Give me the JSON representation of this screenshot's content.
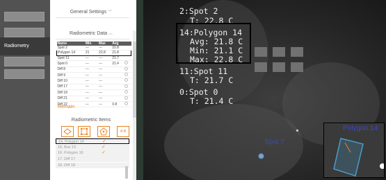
{
  "nav": {
    "active_item": "Radiometry"
  },
  "panel": {
    "general_settings": "General Settings",
    "radiometric_data": "Radiometric Data",
    "table": {
      "headers": [
        "Name",
        "Min",
        "Max",
        "Avg"
      ],
      "rows": [
        {
          "name": "Spot 2",
          "min": "---",
          "max": "---",
          "avg": "22.8"
        },
        {
          "name": "Polygon 14",
          "min": "21",
          "max": "22.8",
          "avg": "21.8"
        },
        {
          "name": "Spot 11",
          "min": "---",
          "max": "---",
          "avg": "21.7"
        },
        {
          "name": "Spot 0",
          "min": "---",
          "max": "---",
          "avg": "21.4"
        },
        {
          "name": "Diff 8",
          "min": "---",
          "max": "---",
          "avg": ""
        },
        {
          "name": "Diff 9",
          "min": "---",
          "max": "---",
          "avg": ""
        },
        {
          "name": "Diff 10",
          "min": "---",
          "max": "---",
          "avg": ""
        },
        {
          "name": "Diff 17",
          "min": "---",
          "max": "---",
          "avg": ""
        },
        {
          "name": "Diff 18",
          "min": "---",
          "max": "---",
          "avg": ""
        },
        {
          "name": "Diff 21",
          "min": "---",
          "max": "---",
          "avg": ""
        },
        {
          "name": "Diff 22",
          "min": "---",
          "max": "---",
          "avg": "0.8"
        }
      ]
    },
    "remain_label": "Remain",
    "radiometric_items": "Radiometric Items",
    "tools": [
      "point-tool",
      "box-tool",
      "polygon-tool",
      "diff-tool"
    ],
    "diff_tool_label": "A-B",
    "list": [
      {
        "label": "14. Polygon 14",
        "checked": true
      },
      {
        "label": "15. Box 15",
        "checked": true
      },
      {
        "label": "16. Polygon 16",
        "checked": true
      },
      {
        "label": "17. Diff 17",
        "checked": false
      },
      {
        "label": "18. Diff 18",
        "checked": false
      }
    ],
    "check_glyph": "✓",
    "accent": "#e8821d"
  },
  "overlay": {
    "spot2": {
      "name": "2:Spot 2",
      "t": "T: 22.8 C"
    },
    "polygon14": {
      "name": "14:Polygon 14",
      "avg": "Avg: 21.8 C",
      "min": "Min: 21.1 C",
      "max": "Max: 22.8 C"
    },
    "spot11": {
      "name": "11:Spot 11",
      "t": "T: 21.7 C"
    },
    "spot0": {
      "name": "0:Spot 0",
      "t": "T: 21.4 C"
    },
    "spot7_label": "Spot 7",
    "polygon_label": "Polygon 14",
    "label_color": "#3b46d4"
  }
}
